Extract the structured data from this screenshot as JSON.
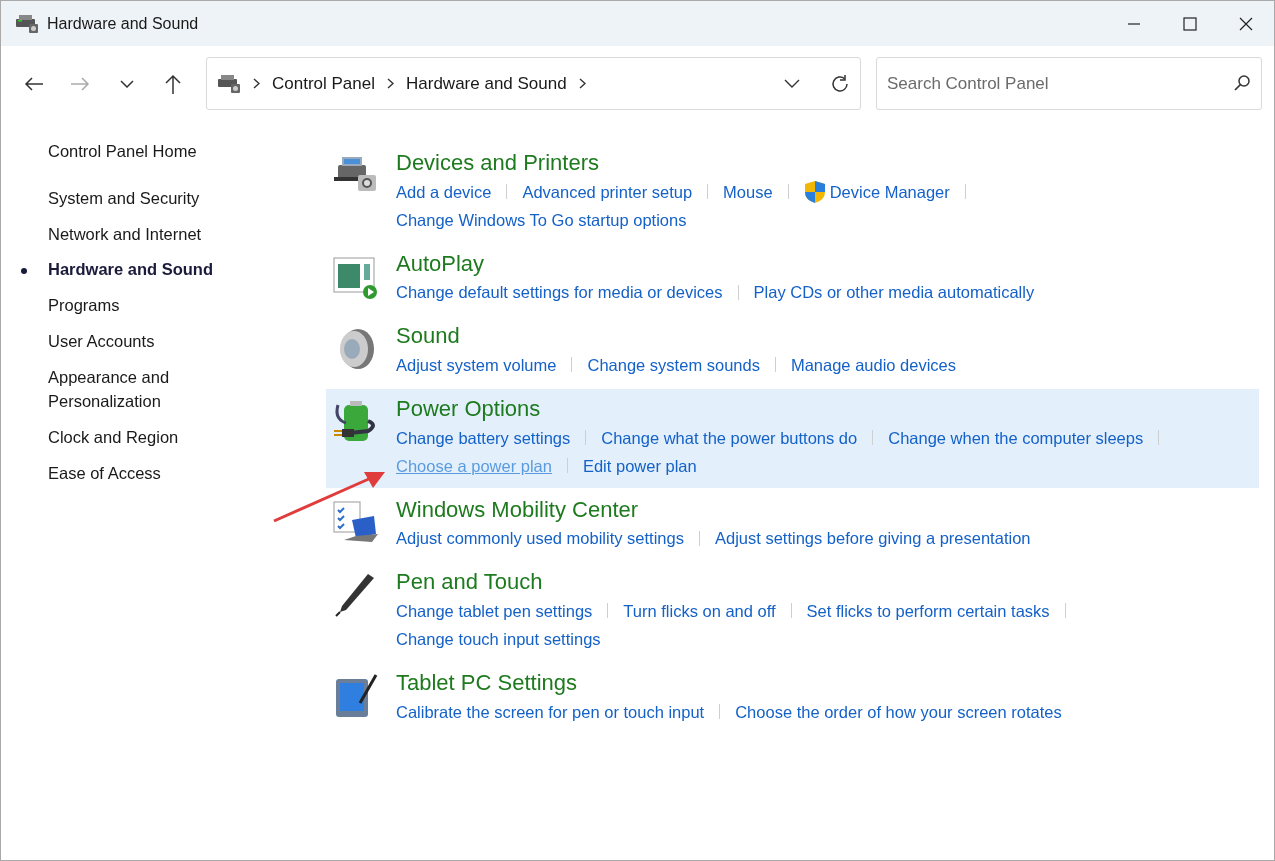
{
  "window": {
    "title": "Hardware and Sound"
  },
  "address_bar": {
    "breadcrumbs": [
      "Control Panel",
      "Hardware and Sound"
    ]
  },
  "search": {
    "placeholder": "Search Control Panel"
  },
  "sidebar": {
    "home": "Control Panel Home",
    "items": [
      {
        "label": "System and Security",
        "selected": false
      },
      {
        "label": "Network and Internet",
        "selected": false
      },
      {
        "label": "Hardware and Sound",
        "selected": true
      },
      {
        "label": "Programs",
        "selected": false
      },
      {
        "label": "User Accounts",
        "selected": false
      },
      {
        "label": "Appearance and Personalization",
        "selected": false
      },
      {
        "label": "Clock and Region",
        "selected": false
      },
      {
        "label": "Ease of Access",
        "selected": false
      }
    ]
  },
  "categories": [
    {
      "title": "Devices and Printers",
      "kind": "printer",
      "highlighted": false,
      "lines": [
        [
          {
            "text": "Add a device",
            "shield": false,
            "hovered": false
          },
          {
            "text": "Advanced printer setup",
            "shield": false,
            "hovered": false
          },
          {
            "text": "Mouse",
            "shield": false,
            "hovered": false
          },
          {
            "text": "Device Manager",
            "shield": true,
            "hovered": false
          }
        ],
        [
          {
            "text": "Change Windows To Go startup options",
            "shield": false,
            "hovered": false
          }
        ]
      ]
    },
    {
      "title": "AutoPlay",
      "kind": "autoplay",
      "highlighted": false,
      "lines": [
        [
          {
            "text": "Change default settings for media or devices",
            "shield": false,
            "hovered": false
          },
          {
            "text": "Play CDs or other media automatically",
            "shield": false,
            "hovered": false
          }
        ]
      ]
    },
    {
      "title": "Sound",
      "kind": "speaker",
      "highlighted": false,
      "lines": [
        [
          {
            "text": "Adjust system volume",
            "shield": false,
            "hovered": false
          },
          {
            "text": "Change system sounds",
            "shield": false,
            "hovered": false
          },
          {
            "text": "Manage audio devices",
            "shield": false,
            "hovered": false
          }
        ]
      ]
    },
    {
      "title": "Power Options",
      "kind": "battery",
      "highlighted": true,
      "lines": [
        [
          {
            "text": "Change battery settings",
            "shield": false,
            "hovered": false
          },
          {
            "text": "Change what the power buttons do",
            "shield": false,
            "hovered": false
          },
          {
            "text": "Change when the computer sleeps",
            "shield": false,
            "hovered": false
          }
        ],
        [
          {
            "text": "Choose a power plan",
            "shield": false,
            "hovered": true
          },
          {
            "text": "Edit power plan",
            "shield": false,
            "hovered": false
          }
        ]
      ]
    },
    {
      "title": "Windows Mobility Center",
      "kind": "laptop",
      "highlighted": false,
      "lines": [
        [
          {
            "text": "Adjust commonly used mobility settings",
            "shield": false,
            "hovered": false
          },
          {
            "text": "Adjust settings before giving a presentation",
            "shield": false,
            "hovered": false
          }
        ]
      ]
    },
    {
      "title": "Pen and Touch",
      "kind": "pen",
      "highlighted": false,
      "lines": [
        [
          {
            "text": "Change tablet pen settings",
            "shield": false,
            "hovered": false
          },
          {
            "text": "Turn flicks on and off",
            "shield": false,
            "hovered": false
          },
          {
            "text": "Set flicks to perform certain tasks",
            "shield": false,
            "hovered": false
          }
        ],
        [
          {
            "text": "Change touch input settings",
            "shield": false,
            "hovered": false
          }
        ]
      ]
    },
    {
      "title": "Tablet PC Settings",
      "kind": "tablet",
      "highlighted": false,
      "lines": [
        [
          {
            "text": "Calibrate the screen for pen or touch input",
            "shield": false,
            "hovered": false
          },
          {
            "text": "Choose the order of how your screen rotates",
            "shield": false,
            "hovered": false
          }
        ]
      ]
    }
  ]
}
